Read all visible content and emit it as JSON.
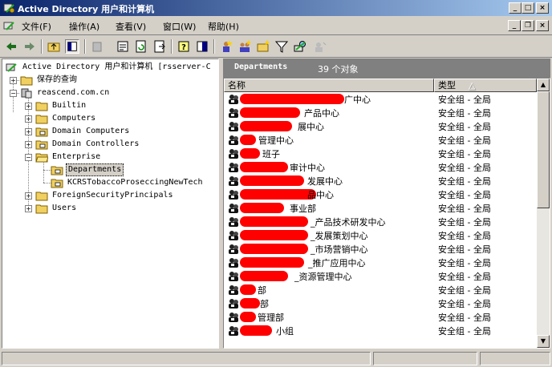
{
  "window": {
    "title": "Active Directory 用户和计算机"
  },
  "menu": {
    "items": [
      "文件(F)",
      "操作(A)",
      "查看(V)",
      "窗口(W)",
      "帮助(H)"
    ]
  },
  "tree": {
    "root": "Active Directory 用户和计算机 [rsserver-C",
    "saved_queries": "保存的查询",
    "domain": "reascend.com.cn",
    "children": [
      "Builtin",
      "Computers",
      "Domain Computers",
      "Domain Controllers",
      "Enterprise",
      "ForeignSecurityPrincipals",
      "Users"
    ],
    "enterprise_children": [
      "Departments",
      "KCRSTobaccoProseccingNewTech"
    ]
  },
  "panel": {
    "title": "Departments",
    "count": "39 个对象"
  },
  "columns": {
    "name": "名称",
    "type": "类型"
  },
  "rows": [
    {
      "name": "广中心",
      "type": "安全组 - 全局"
    },
    {
      "name": "产品中心",
      "type": "安全组 - 全局"
    },
    {
      "name": "展中心",
      "type": "安全组 - 全局"
    },
    {
      "name": "管理中心",
      "type": "安全组 - 全局"
    },
    {
      "name": "班子",
      "type": "安全组 - 全局"
    },
    {
      "name": "审计中心",
      "type": "安全组 - 全局"
    },
    {
      "name": "发展中心",
      "type": "安全组 - 全局"
    },
    {
      "name": "品中心",
      "type": "安全组 - 全局"
    },
    {
      "name": "事业部",
      "type": "安全组 - 全局"
    },
    {
      "name": "_产品技术研发中心",
      "type": "安全组 - 全局"
    },
    {
      "name": "_发展策划中心",
      "type": "安全组 - 全局"
    },
    {
      "name": "_市场营销中心",
      "type": "安全组 - 全局"
    },
    {
      "name": "_推广应用中心",
      "type": "安全组 - 全局"
    },
    {
      "name": "_资源管理中心",
      "type": "安全组 - 全局"
    },
    {
      "name": "部",
      "type": "安全组 - 全局"
    },
    {
      "name": "部",
      "type": "安全组 - 全局"
    },
    {
      "name": "管理部",
      "type": "安全组 - 全局"
    },
    {
      "name": "小组",
      "type": "安全组 - 全局"
    }
  ]
}
